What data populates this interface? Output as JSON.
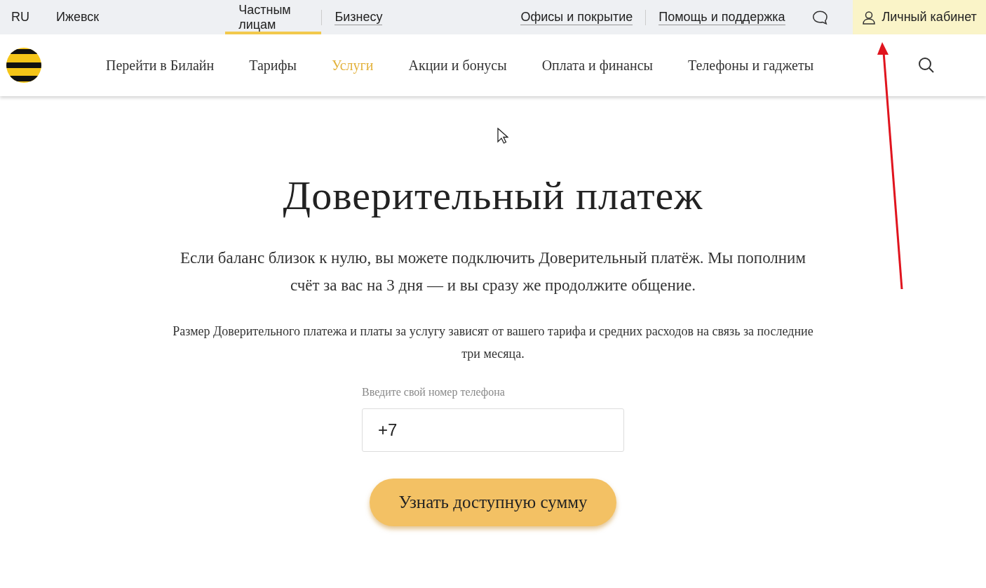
{
  "top_bar": {
    "language": "RU",
    "city": "Ижевск",
    "segments": [
      {
        "label": "Частным лицам",
        "selected": true
      },
      {
        "label": "Бизнесу",
        "selected": false
      }
    ],
    "links": [
      "Офисы и покрытие",
      "Помощь и поддержка"
    ],
    "account_button": "Личный кабинет"
  },
  "nav": {
    "items": [
      {
        "label": "Перейти в Билайн",
        "selected": false
      },
      {
        "label": "Тарифы",
        "selected": false
      },
      {
        "label": "Услуги",
        "selected": true
      },
      {
        "label": "Акции и бонусы",
        "selected": false
      },
      {
        "label": "Оплата и финансы",
        "selected": false
      },
      {
        "label": "Телефоны и гаджеты",
        "selected": false
      }
    ]
  },
  "page": {
    "title": "Доверительный платеж",
    "lead": "Если баланс близок к нулю, вы можете подключить Доверительный платёж. Мы пополним счёт за вас на 3 дня — и вы сразу же продолжите общение.",
    "note": "Размер Доверительного платежа и платы за услугу зависят от вашего тарифа и средних расходов на связь за последние три месяца.",
    "phone_field": {
      "label": "Введите свой номер телефона",
      "value": "+7"
    },
    "submit_button": "Узнать доступную сумму"
  }
}
